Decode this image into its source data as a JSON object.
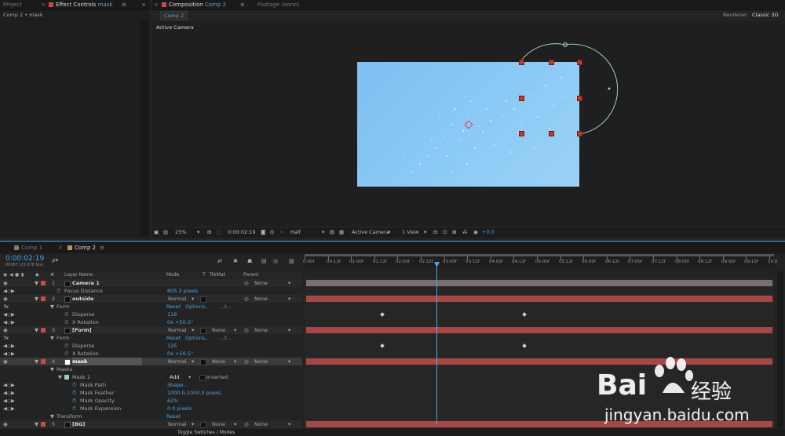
{
  "panels": {
    "project_tab": "Project",
    "effect_controls_tab": "Effect Controls",
    "effect_controls_layer": "mask",
    "effect_breadcrumb": "Comp 2 • mask",
    "composition_tab": "Composition",
    "composition_name": "Comp 2",
    "footage_tab": "Footage (none)",
    "comp_subtab": "Comp 2",
    "renderer_label": "Renderer:",
    "renderer_value": "Classic 3D",
    "active_camera": "Active Camera"
  },
  "viewer_toolbar": {
    "zoom": "25%",
    "timecode": "0:00:02:19",
    "resolution": "Half",
    "view_camera": "Active Camera",
    "views": "1 View",
    "exposure": "+0.0"
  },
  "timeline": {
    "tabs": [
      "Comp 1",
      "Comp 2"
    ],
    "timecode": "0:00:02:19",
    "frame_info": "00067 (23.976 fps)",
    "search_placeholder": "ρ▾",
    "col_num": "#",
    "col_layer": "Layer Name",
    "col_mode": "Mode",
    "col_t": "T",
    "col_trkmat": "TrkMat",
    "col_parent": "Parent",
    "ruler": [
      "0:00f",
      "00:12f",
      "01:00f",
      "01:12f",
      "02:00f",
      "02:12f",
      "03:00f",
      "03:12f",
      "04:00f",
      "04:12f",
      "05:00f",
      "05:12f",
      "06:00f",
      "06:12f",
      "07:00f",
      "07:12f",
      "08:00f",
      "08:12f",
      "09:00f",
      "09:12f",
      "10:0"
    ],
    "footer": "Toggle Switches / Modes"
  },
  "layers": [
    {
      "kind": "layer",
      "num": "1",
      "name": "Camera 1",
      "mode": "",
      "trkmat": "",
      "parent": "None",
      "color": "#c84a4a",
      "bar": "#7c6e6e",
      "indent": 0
    },
    {
      "kind": "prop",
      "name": "Focus Distance",
      "value": "605.3 pixels",
      "indent": 1,
      "stopwatch": true
    },
    {
      "kind": "layer",
      "num": "2",
      "name": "outside",
      "mode": "Normal",
      "trkmat": "",
      "parent": "None",
      "color": "#c84a4a",
      "bar": "#a64747",
      "indent": 0
    },
    {
      "kind": "group",
      "name": "Form",
      "reset": "Reset",
      "options": "Options...",
      "extra": "...t...",
      "indent": 1
    },
    {
      "kind": "prop",
      "name": "Disperse",
      "value": "118",
      "indent": 2,
      "stopwatch": true,
      "kf": [
        485,
        666
      ]
    },
    {
      "kind": "prop",
      "name": "X Rotation",
      "value": "0x +50.5°",
      "indent": 2,
      "stopwatch": true
    },
    {
      "kind": "layer",
      "num": "3",
      "name": "[Form]",
      "mode": "Normal",
      "trkmat": "None",
      "parent": "None",
      "color": "#c84a4a",
      "bar": "#a64747",
      "indent": 0
    },
    {
      "kind": "group",
      "name": "Form",
      "reset": "Reset",
      "options": "Options...",
      "extra": "...t...",
      "indent": 1
    },
    {
      "kind": "prop",
      "name": "Disperse",
      "value": "125",
      "indent": 2,
      "stopwatch": true,
      "kf": [
        485,
        666
      ]
    },
    {
      "kind": "prop",
      "name": "X Rotation",
      "value": "0x +50.5°",
      "indent": 2,
      "stopwatch": true
    },
    {
      "kind": "layer",
      "num": "4",
      "name": "mask",
      "mode": "Normal",
      "trkmat": "None",
      "parent": "None",
      "color": "#c84a4a",
      "bar": "#a64747",
      "indent": 0,
      "selected": true
    },
    {
      "kind": "group",
      "name": "Masks",
      "indent": 1
    },
    {
      "kind": "mask",
      "name": "Mask 1",
      "mode": "Add",
      "inverted": "Inverted",
      "indent": 2
    },
    {
      "kind": "prop",
      "name": "Mask Path",
      "value": "Shape...",
      "indent": 3,
      "stopwatch": true
    },
    {
      "kind": "prop",
      "name": "Mask Feather",
      "value": "1000.0,1000.0 pixels",
      "indent": 3,
      "stopwatch": true
    },
    {
      "kind": "prop",
      "name": "Mask Opacity",
      "value": "62%",
      "indent": 3,
      "stopwatch": true
    },
    {
      "kind": "prop",
      "name": "Mask Expansion",
      "value": "0.0 pixels",
      "indent": 3,
      "stopwatch": true
    },
    {
      "kind": "group",
      "name": "Transform",
      "reset": "Reset",
      "indent": 1
    },
    {
      "kind": "layer",
      "num": "5",
      "name": "[BG]",
      "mode": "Normal",
      "trkmat": "None",
      "parent": "None",
      "color": "#c84a4a",
      "bar": "#a64747",
      "indent": 0
    }
  ],
  "watermark": {
    "brand": "Bai",
    "brand_cn": "经验",
    "url": "jingyan.baidu.com"
  },
  "colors": {
    "accent": "#4fa3e0",
    "label_red": "#c84a4a",
    "bar_red": "#a64747",
    "canvas": "#87c4f2"
  }
}
